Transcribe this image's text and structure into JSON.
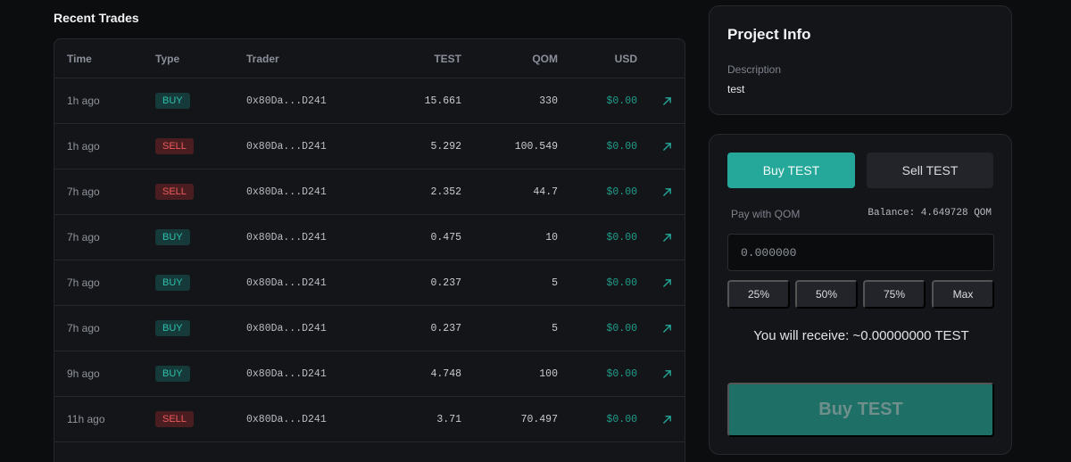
{
  "recent_trades": {
    "title": "Recent Trades",
    "columns": [
      "Time",
      "Type",
      "Trader",
      "TEST",
      "QOM",
      "USD"
    ],
    "rows": [
      {
        "time": "1h ago",
        "type": "BUY",
        "trader": "0x80Da...D241",
        "test": "15.661",
        "qom": "330",
        "usd": "$0.00"
      },
      {
        "time": "1h ago",
        "type": "SELL",
        "trader": "0x80Da...D241",
        "test": "5.292",
        "qom": "100.549",
        "usd": "$0.00"
      },
      {
        "time": "7h ago",
        "type": "SELL",
        "trader": "0x80Da...D241",
        "test": "2.352",
        "qom": "44.7",
        "usd": "$0.00"
      },
      {
        "time": "7h ago",
        "type": "BUY",
        "trader": "0x80Da...D241",
        "test": "0.475",
        "qom": "10",
        "usd": "$0.00"
      },
      {
        "time": "7h ago",
        "type": "BUY",
        "trader": "0x80Da...D241",
        "test": "0.237",
        "qom": "5",
        "usd": "$0.00"
      },
      {
        "time": "7h ago",
        "type": "BUY",
        "trader": "0x80Da...D241",
        "test": "0.237",
        "qom": "5",
        "usd": "$0.00"
      },
      {
        "time": "9h ago",
        "type": "BUY",
        "trader": "0x80Da...D241",
        "test": "4.748",
        "qom": "100",
        "usd": "$0.00"
      },
      {
        "time": "11h ago",
        "type": "SELL",
        "trader": "0x80Da...D241",
        "test": "3.71",
        "qom": "70.497",
        "usd": "$0.00"
      }
    ],
    "row_link_icon": "external-link-arrow-icon"
  },
  "project_info": {
    "title": "Project Info",
    "description_label": "Description",
    "description_value": "test"
  },
  "trade_panel": {
    "buy_tab": "Buy TEST",
    "sell_tab": "Sell TEST",
    "pay_label": "Pay with QOM",
    "balance": "Balance: 4.649728 QOM",
    "amount_placeholder": "0.000000",
    "percent_buttons": [
      "25%",
      "50%",
      "75%",
      "Max"
    ],
    "receive_text": "You will receive: ~0.00000000 TEST",
    "submit_label": "Buy TEST"
  },
  "colors": {
    "accent": "#25a89a",
    "buy_badge": "#2fc1ad",
    "sell_badge": "#ee5a5a",
    "background": "#0c0d0f",
    "card": "#141518"
  }
}
